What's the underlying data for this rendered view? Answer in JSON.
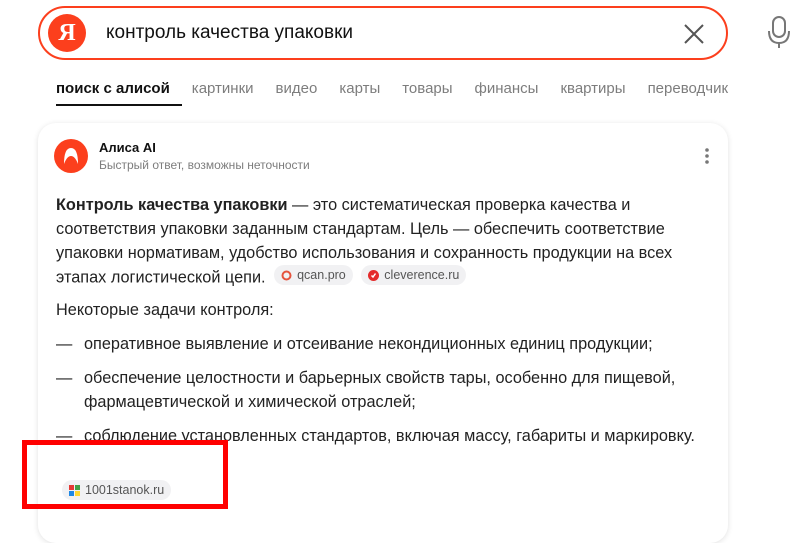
{
  "search": {
    "logo_letter": "Я",
    "query": "контроль качества упаковки"
  },
  "tabs": [
    {
      "label": "поиск с алисой",
      "active": true
    },
    {
      "label": "картинки"
    },
    {
      "label": "видео"
    },
    {
      "label": "карты"
    },
    {
      "label": "товары"
    },
    {
      "label": "финансы"
    },
    {
      "label": "квартиры"
    },
    {
      "label": "переводчик"
    }
  ],
  "answer": {
    "brand": "Алиса AI",
    "subtitle": "Быстрый ответ, возможны неточности",
    "intro_bold": "Контроль качества упаковки",
    "intro_rest": " — это систематическая проверка качества и соответствия упаковки заданным стандартам. Цель — обеспечить соответствие упаковки нормативам, удобство использования и сохранность продукции на всех этапах логистической цепи.",
    "sources": [
      "qcan.pro",
      "cleverence.ru"
    ],
    "tasks_heading": "Некоторые задачи контроля:",
    "list": [
      "оперативное выявление и отсеивание некондиционных единиц продукции;",
      "обеспечение целостности и барьерных свойств тары, особенно для пищевой, фармацевтической и химической отраслей;",
      "соблюдение установленных стандартов, включая массу, габариты и маркировку."
    ],
    "bottom_source": "1001stanok.ru"
  },
  "colors": {
    "accent": "#fc3f1d",
    "highlight": "#ff0000"
  }
}
